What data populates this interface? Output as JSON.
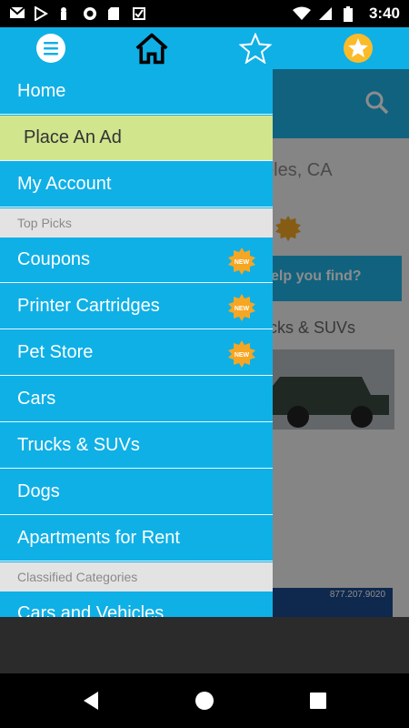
{
  "status_bar": {
    "time": "3:40",
    "icons_left": [
      "gmail-icon",
      "play-store-icon",
      "keyhole-icon",
      "record-icon",
      "sd-card-icon",
      "checkbox-icon"
    ],
    "icons_right": [
      "wifi-icon",
      "signal-icon",
      "battery-icon"
    ]
  },
  "top_bar": {
    "icons": [
      "menu-icon",
      "home-icon",
      "star-outline-icon",
      "favorite-star-icon"
    ]
  },
  "drawer": {
    "home": "Home",
    "place_ad": "Place An Ad",
    "my_account": "My Account",
    "top_picks_header": "Top Picks",
    "coupons": "Coupons",
    "printer_cartridges": "Printer Cartridges",
    "pet_store": "Pet Store",
    "cars": "Cars",
    "trucks_suvs": "Trucks & SUVs",
    "dogs": "Dogs",
    "apartments": "Apartments for Rent",
    "classified_header": "Classified Categories",
    "cars_vehicles": "Cars and Vehicles",
    "new_badge": "NEW"
  },
  "background": {
    "location": "eles, CA",
    "help_banner": "elp you find?",
    "category": "cks & SUVs",
    "phone": "877.207.9020"
  },
  "colors": {
    "accent": "#0fb0e6",
    "highlight": "#d1e58d",
    "section_bg": "#e3e3e3",
    "badge": "#f5a623"
  }
}
